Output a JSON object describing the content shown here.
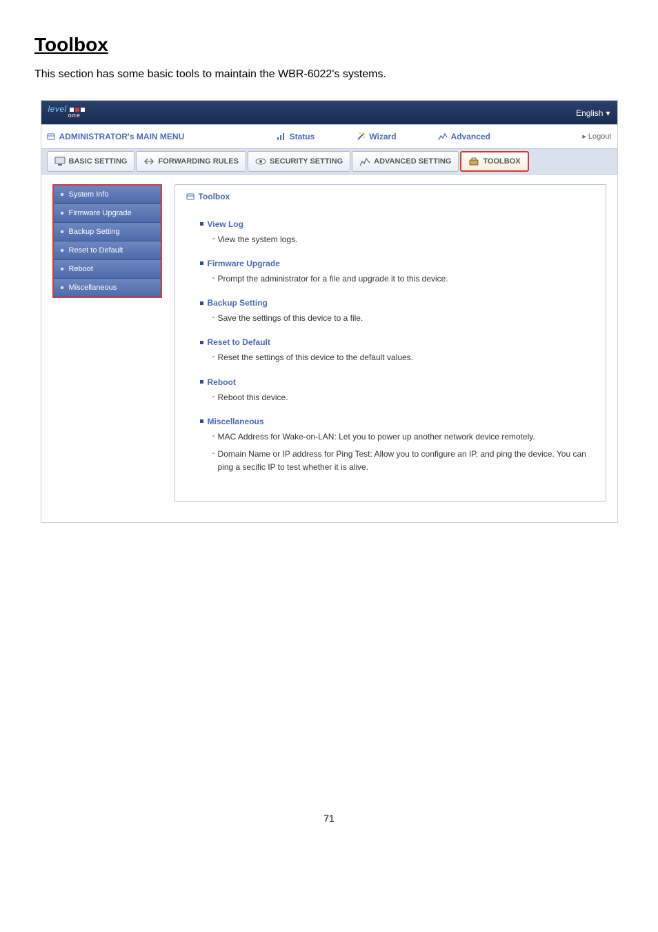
{
  "doc": {
    "title": "Toolbox",
    "intro": "This section has some basic tools to maintain the WBR-6022's systems.",
    "page_number": "71"
  },
  "top": {
    "brand": "level",
    "brand_sub": "one",
    "language_label": "English"
  },
  "nav": {
    "main_menu": "ADMINISTRATOR's MAIN MENU",
    "status": "Status",
    "wizard": "Wizard",
    "advanced": "Advanced",
    "logout": "Logout"
  },
  "tabs": {
    "basic": "BASIC SETTING",
    "forwarding": "FORWARDING RULES",
    "security": "SECURITY SETTING",
    "advanced": "ADVANCED SETTING",
    "toolbox": "TOOLBOX"
  },
  "sidebar": [
    "System Info",
    "Firmware Upgrade",
    "Backup Setting",
    "Reset to Default",
    "Reboot",
    "Miscellaneous"
  ],
  "main": {
    "title": "Toolbox",
    "features": [
      {
        "title": "View Log",
        "desc": [
          "View the system logs."
        ]
      },
      {
        "title": "Firmware Upgrade",
        "desc": [
          "Prompt the administrator for a file and upgrade it to this device."
        ]
      },
      {
        "title": "Backup Setting",
        "desc": [
          "Save the settings of this device to a file."
        ]
      },
      {
        "title": "Reset to Default",
        "desc": [
          "Reset the settings of this device to the default values."
        ]
      },
      {
        "title": "Reboot",
        "desc": [
          "Reboot this device."
        ]
      },
      {
        "title": "Miscellaneous",
        "desc": [
          "MAC Address for Wake-on-LAN: Let you to power up another network device remotely.",
          "Domain Name or IP address for Ping Test: Allow you to configure an IP, and ping the device. You can ping a secific IP to test whether it is alive."
        ]
      }
    ]
  }
}
